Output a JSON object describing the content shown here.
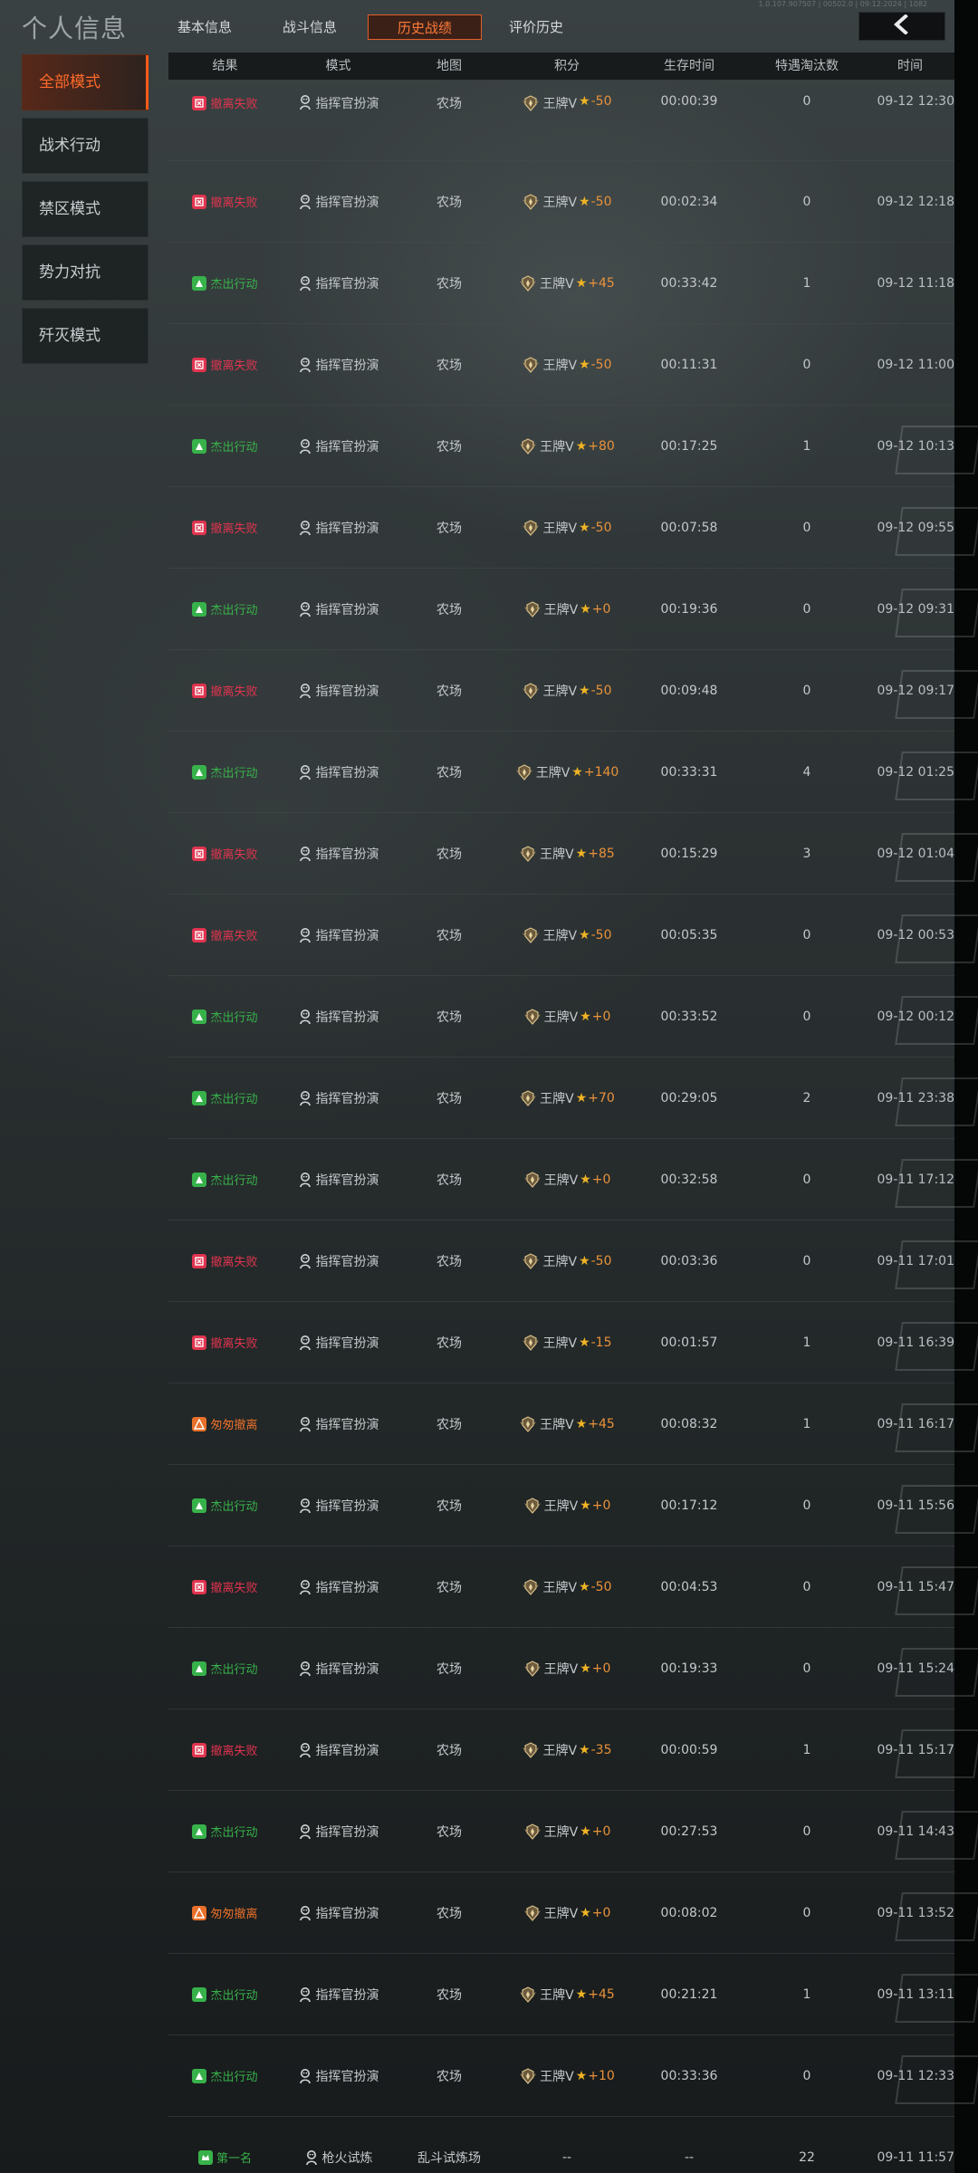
{
  "header": {
    "title": "个人信息",
    "version": "1.0.107.907507 | 00502.0 | 09:12:2024 | 1082",
    "tabs": [
      {
        "label": "基本信息",
        "active": false
      },
      {
        "label": "战斗信息",
        "active": false
      },
      {
        "label": "历史战绩",
        "active": true
      },
      {
        "label": "评价历史",
        "active": false
      }
    ],
    "back_icon": "chevron-left-icon"
  },
  "sidebar": {
    "items": [
      {
        "label": "全部模式",
        "active": true
      },
      {
        "label": "战术行动",
        "active": false
      },
      {
        "label": "禁区模式",
        "active": false
      },
      {
        "label": "势力对抗",
        "active": false
      },
      {
        "label": "歼灭模式",
        "active": false
      }
    ]
  },
  "table": {
    "columns": [
      "结果",
      "模式",
      "地图",
      "积分",
      "生存时间",
      "特遇淘汰数",
      "时间"
    ],
    "rank_label": "王牌V",
    "rows": [
      {
        "result": "撤离失败",
        "type": "fail",
        "mode": "指挥官扮演",
        "map": "农场",
        "delta": "-50",
        "survival": "00:00:39",
        "kills": "0",
        "time": "09-12 12:30"
      },
      {
        "result": "撤离失败",
        "type": "fail",
        "mode": "指挥官扮演",
        "map": "农场",
        "delta": "-50",
        "survival": "00:02:34",
        "kills": "0",
        "time": "09-12 12:18"
      },
      {
        "result": "杰出行动",
        "type": "success",
        "mode": "指挥官扮演",
        "map": "农场",
        "delta": "+45",
        "survival": "00:33:42",
        "kills": "1",
        "time": "09-12 11:18"
      },
      {
        "result": "撤离失败",
        "type": "fail",
        "mode": "指挥官扮演",
        "map": "农场",
        "delta": "-50",
        "survival": "00:11:31",
        "kills": "0",
        "time": "09-12 11:00"
      },
      {
        "result": "杰出行动",
        "type": "success",
        "mode": "指挥官扮演",
        "map": "农场",
        "delta": "+80",
        "survival": "00:17:25",
        "kills": "1",
        "time": "09-12 10:13"
      },
      {
        "result": "撤离失败",
        "type": "fail",
        "mode": "指挥官扮演",
        "map": "农场",
        "delta": "-50",
        "survival": "00:07:58",
        "kills": "0",
        "time": "09-12 09:55"
      },
      {
        "result": "杰出行动",
        "type": "success",
        "mode": "指挥官扮演",
        "map": "农场",
        "delta": "+0",
        "survival": "00:19:36",
        "kills": "0",
        "time": "09-12 09:31"
      },
      {
        "result": "撤离失败",
        "type": "fail",
        "mode": "指挥官扮演",
        "map": "农场",
        "delta": "-50",
        "survival": "00:09:48",
        "kills": "0",
        "time": "09-12 09:17"
      },
      {
        "result": "杰出行动",
        "type": "success",
        "mode": "指挥官扮演",
        "map": "农场",
        "delta": "+140",
        "survival": "00:33:31",
        "kills": "4",
        "time": "09-12 01:25"
      },
      {
        "result": "撤离失败",
        "type": "fail",
        "mode": "指挥官扮演",
        "map": "农场",
        "delta": "+85",
        "survival": "00:15:29",
        "kills": "3",
        "time": "09-12 01:04"
      },
      {
        "result": "撤离失败",
        "type": "fail",
        "mode": "指挥官扮演",
        "map": "农场",
        "delta": "-50",
        "survival": "00:05:35",
        "kills": "0",
        "time": "09-12 00:53"
      },
      {
        "result": "杰出行动",
        "type": "success",
        "mode": "指挥官扮演",
        "map": "农场",
        "delta": "+0",
        "survival": "00:33:52",
        "kills": "0",
        "time": "09-12 00:12"
      },
      {
        "result": "杰出行动",
        "type": "success",
        "mode": "指挥官扮演",
        "map": "农场",
        "delta": "+70",
        "survival": "00:29:05",
        "kills": "2",
        "time": "09-11 23:38"
      },
      {
        "result": "杰出行动",
        "type": "success",
        "mode": "指挥官扮演",
        "map": "农场",
        "delta": "+0",
        "survival": "00:32:58",
        "kills": "0",
        "time": "09-11 17:12"
      },
      {
        "result": "撤离失败",
        "type": "fail",
        "mode": "指挥官扮演",
        "map": "农场",
        "delta": "-50",
        "survival": "00:03:36",
        "kills": "0",
        "time": "09-11 17:01"
      },
      {
        "result": "撤离失败",
        "type": "fail",
        "mode": "指挥官扮演",
        "map": "农场",
        "delta": "-15",
        "survival": "00:01:57",
        "kills": "1",
        "time": "09-11 16:39"
      },
      {
        "result": "匆匆撤离",
        "type": "hasty",
        "mode": "指挥官扮演",
        "map": "农场",
        "delta": "+45",
        "survival": "00:08:32",
        "kills": "1",
        "time": "09-11 16:17"
      },
      {
        "result": "杰出行动",
        "type": "success",
        "mode": "指挥官扮演",
        "map": "农场",
        "delta": "+0",
        "survival": "00:17:12",
        "kills": "0",
        "time": "09-11 15:56"
      },
      {
        "result": "撤离失败",
        "type": "fail",
        "mode": "指挥官扮演",
        "map": "农场",
        "delta": "-50",
        "survival": "00:04:53",
        "kills": "0",
        "time": "09-11 15:47"
      },
      {
        "result": "杰出行动",
        "type": "success",
        "mode": "指挥官扮演",
        "map": "农场",
        "delta": "+0",
        "survival": "00:19:33",
        "kills": "0",
        "time": "09-11 15:24"
      },
      {
        "result": "撤离失败",
        "type": "fail",
        "mode": "指挥官扮演",
        "map": "农场",
        "delta": "-35",
        "survival": "00:00:59",
        "kills": "1",
        "time": "09-11 15:17"
      },
      {
        "result": "杰出行动",
        "type": "success",
        "mode": "指挥官扮演",
        "map": "农场",
        "delta": "+0",
        "survival": "00:27:53",
        "kills": "0",
        "time": "09-11 14:43"
      },
      {
        "result": "匆匆撤离",
        "type": "hasty",
        "mode": "指挥官扮演",
        "map": "农场",
        "delta": "+0",
        "survival": "00:08:02",
        "kills": "0",
        "time": "09-11 13:52"
      },
      {
        "result": "杰出行动",
        "type": "success",
        "mode": "指挥官扮演",
        "map": "农场",
        "delta": "+45",
        "survival": "00:21:21",
        "kills": "1",
        "time": "09-11 13:11"
      },
      {
        "result": "杰出行动",
        "type": "success",
        "mode": "指挥官扮演",
        "map": "农场",
        "delta": "+10",
        "survival": "00:33:36",
        "kills": "0",
        "time": "09-11 12:33"
      },
      {
        "result": "第一名",
        "type": "first",
        "mode": "枪火试炼",
        "map": "乱斗试炼场",
        "score": "--",
        "survival": "--",
        "kills": "22",
        "time": "09-11 11:57"
      }
    ]
  },
  "colors": {
    "fail": "#e0344f",
    "success": "#37b24a",
    "hasty": "#e8702a",
    "accent": "#ff6a2a",
    "delta": "#e8923a"
  }
}
